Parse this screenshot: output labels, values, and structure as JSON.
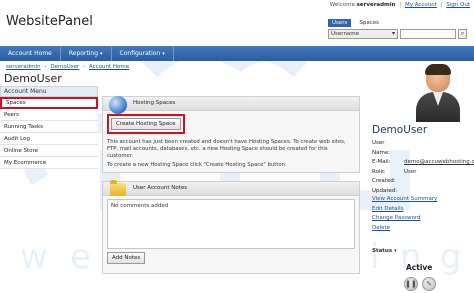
{
  "header": {
    "logo": "WebsitePanel",
    "welcome_prefix": "Welcome",
    "username": "serveradmin",
    "my_account": "My Account",
    "sign_out": "Sign Out"
  },
  "search": {
    "tab_users": "Users",
    "tab_spaces": "Spaces",
    "selected_field": "Username",
    "query": "",
    "button_icon": "search-icon"
  },
  "nav": {
    "items": [
      "Account Home",
      "Reporting",
      "Configuration"
    ]
  },
  "breadcrumb": [
    "serveradmin",
    "DemoUser",
    "Account Home"
  ],
  "page_title": "DemoUser",
  "account_menu": {
    "title": "Account Menu",
    "items": [
      "Spaces",
      "Peers",
      "Running Tasks",
      "Audit Log",
      "Online Store",
      "My Ecommerce"
    ]
  },
  "hosting": {
    "title": "Hosting Spaces",
    "create_button": "Create Hosting Space",
    "text1": "This account has just been created and doesn't have Hosting Spaces. To create web sites, FTP, mail accounts, databases, etc. a new Hosting Space should be created for this customer.",
    "text2": "To create a new Hosting Space click \"Create Hosting Space\" button."
  },
  "notes": {
    "title": "User Account Notes",
    "content": "No comments added",
    "add_button": "Add Notes"
  },
  "profile": {
    "name": "DemoUser",
    "labels": [
      "User Name:",
      "E-Mail:",
      "Role:",
      "Created:",
      "Updated:"
    ],
    "values": [
      "",
      "demo@accuwebhosting.com",
      "User",
      "",
      ""
    ],
    "links": [
      "View Account Summary",
      "Edit Details",
      "Change Password",
      "Delete"
    ],
    "status_label": "Status",
    "status_value": "Active"
  },
  "colors": {
    "nav": "#2f66ae",
    "highlight": "#d0101e",
    "link": "#1f4e9b"
  }
}
